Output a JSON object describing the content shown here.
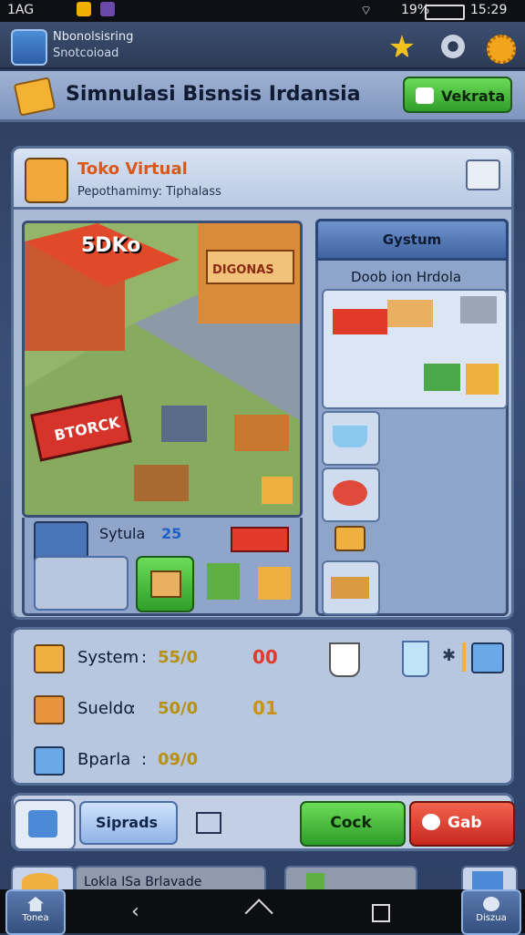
{
  "status_bar": {
    "left_text": "1AG",
    "battery": "19%",
    "time": "15:29"
  },
  "top_bar": {
    "line1": "Nbonolsisring",
    "line2": "Snotcoioad"
  },
  "title_row": {
    "title": "Simnulasi Bisnsis Irdansia",
    "button": "Vekrata"
  },
  "store": {
    "name": "Toko Virtual",
    "subtitle": "Pepothamimy: Tiphalass"
  },
  "scene": {
    "badge": "5DKo",
    "sign_top": "DIGONAS",
    "sign_bottom": "BTORCK"
  },
  "bottom_left": {
    "label": "Sytula",
    "value": "25"
  },
  "side_panel": {
    "header": "Gystum",
    "subheader": "Doob ion Hrdola"
  },
  "stats": [
    {
      "label": "System",
      "value": "55/0",
      "count": "00",
      "count_color": "#e03a2a"
    },
    {
      "label": "Sueldo",
      "value": "50/0",
      "count": "01",
      "count_color": "#c8930f"
    },
    {
      "label": "Bparla",
      "value": "09/0",
      "count": "",
      "count_color": "#c8930f"
    }
  ],
  "actions": {
    "secondary": "Siprads",
    "cock": "Cock",
    "red": "Gab"
  },
  "lower_tab": {
    "label": "Lokla ISa Brlavade"
  },
  "nav": {
    "home_label": "Tonea",
    "right_label": "Diszua"
  },
  "colors": {
    "accent_green": "#3fb034",
    "accent_red": "#d9372a",
    "panel": "#a9bad6"
  }
}
